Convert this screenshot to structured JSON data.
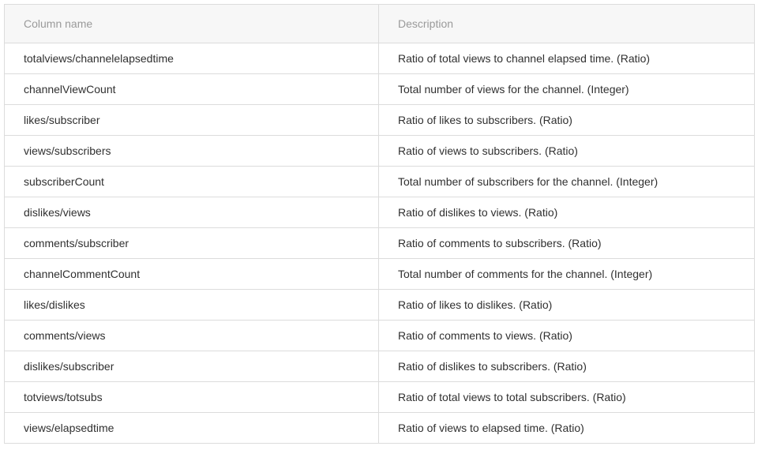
{
  "table": {
    "headers": [
      "Column name",
      "Description"
    ],
    "rows": [
      [
        "totalviews/channelelapsedtime",
        "Ratio of total views to channel elapsed time. (Ratio)"
      ],
      [
        "channelViewCount",
        "Total number of views for the channel. (Integer)"
      ],
      [
        "likes/subscriber",
        "Ratio of likes to subscribers. (Ratio)"
      ],
      [
        "views/subscribers",
        "Ratio of views to subscribers. (Ratio)"
      ],
      [
        "subscriberCount",
        "Total number of subscribers for the channel. (Integer)"
      ],
      [
        "dislikes/views",
        "Ratio of dislikes to views. (Ratio)"
      ],
      [
        "comments/subscriber",
        "Ratio of comments to subscribers. (Ratio)"
      ],
      [
        "channelCommentCount",
        "Total number of comments for the channel. (Integer)"
      ],
      [
        "likes/dislikes",
        "Ratio of likes to dislikes. (Ratio)"
      ],
      [
        "comments/views",
        "Ratio of comments to views. (Ratio)"
      ],
      [
        "dislikes/subscriber",
        "Ratio of dislikes to subscribers. (Ratio)"
      ],
      [
        "totviews/totsubs",
        "Ratio of total views to total subscribers. (Ratio)"
      ],
      [
        "views/elapsedtime",
        "Ratio of views to elapsed time. (Ratio)"
      ]
    ]
  }
}
